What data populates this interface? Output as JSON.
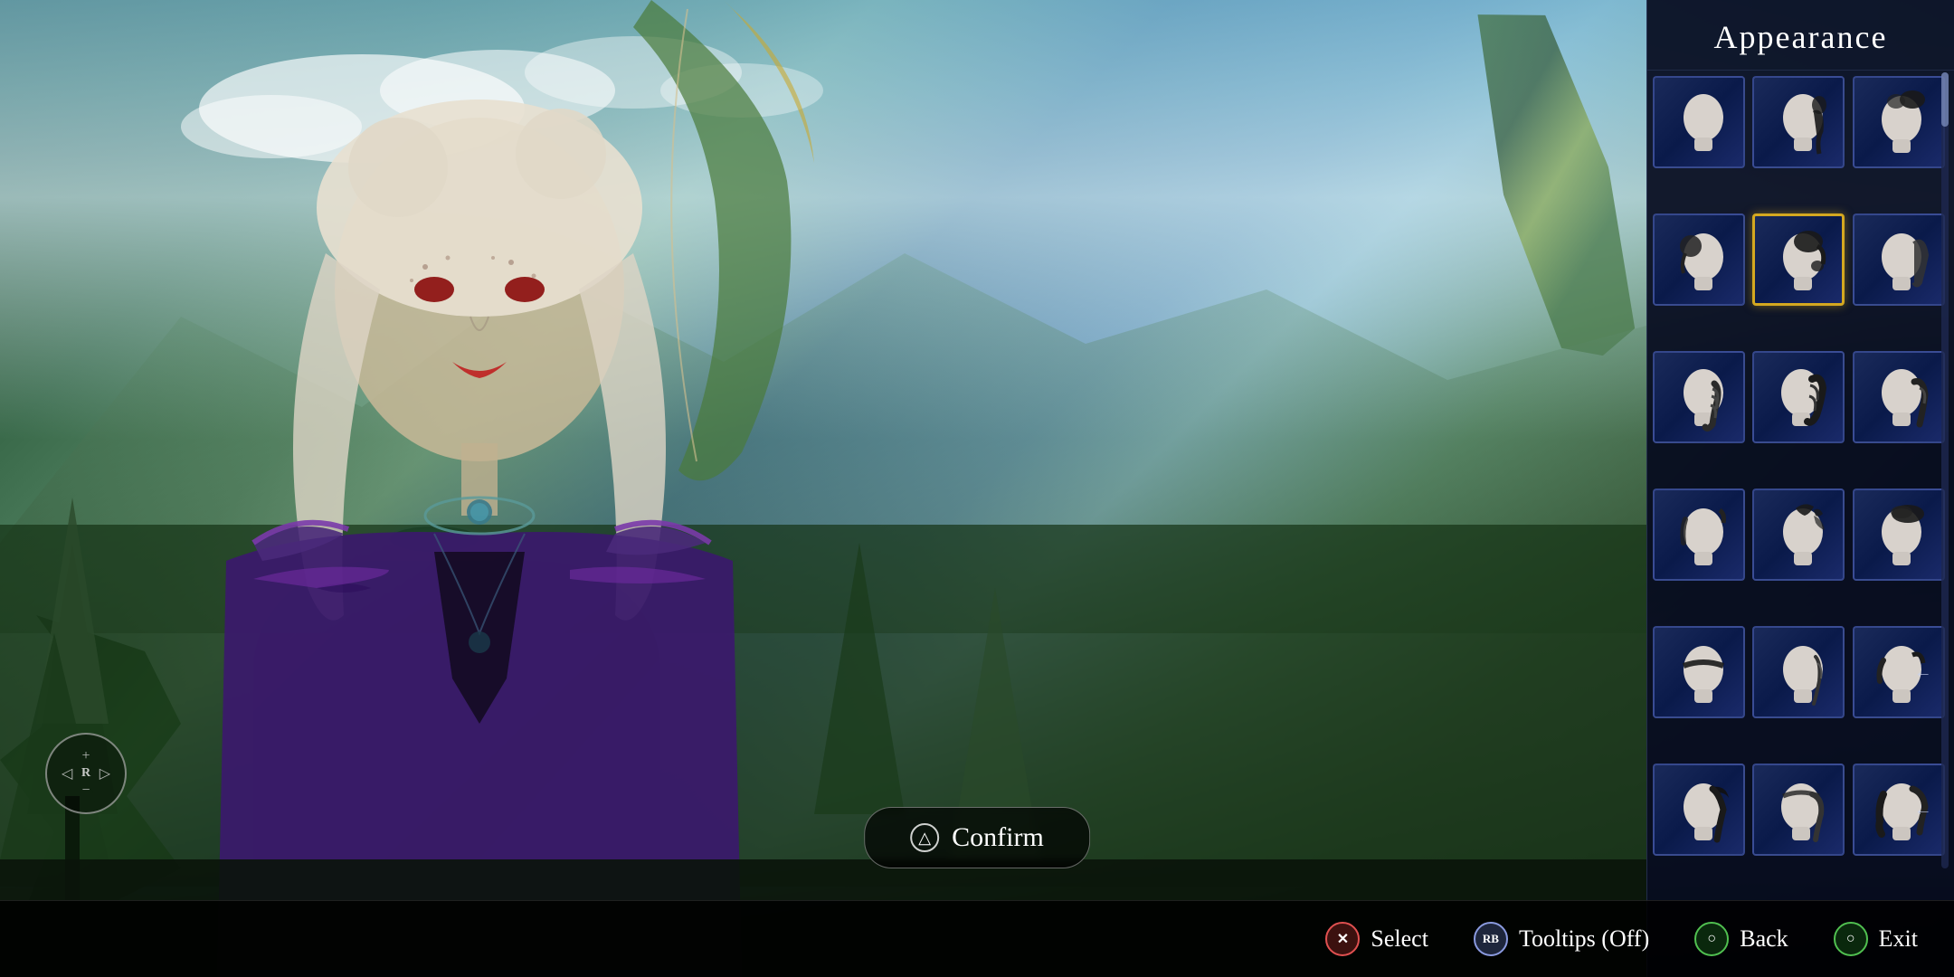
{
  "ui": {
    "title": "Appearance",
    "confirm_button": {
      "label": "Confirm",
      "icon": "△"
    },
    "compass": {
      "label": "R",
      "plus": "+",
      "minus": "-"
    },
    "bottom_bar": {
      "actions": [
        {
          "icon": "✕",
          "label": "Select",
          "icon_class": "cross"
        },
        {
          "icon": "RB",
          "label": "Tooltips (Off)",
          "icon_class": "plain"
        },
        {
          "icon": "○",
          "label": "Back",
          "icon_class": "circle"
        },
        {
          "icon": "○",
          "label": "Exit",
          "icon_class": "circle"
        }
      ]
    },
    "hair_grid": {
      "rows": 6,
      "cols": 3,
      "selected_row": 1,
      "selected_col": 1,
      "items": [
        {
          "id": 0,
          "row": 0,
          "col": 0,
          "style": "bald"
        },
        {
          "id": 1,
          "row": 0,
          "col": 1,
          "style": "ponytail-low"
        },
        {
          "id": 2,
          "row": 0,
          "col": 2,
          "style": "bun-top"
        },
        {
          "id": 3,
          "row": 1,
          "col": 0,
          "style": "bun-side"
        },
        {
          "id": 4,
          "row": 1,
          "col": 1,
          "style": "bun-back",
          "selected": true
        },
        {
          "id": 5,
          "row": 1,
          "col": 2,
          "style": "ponytail-side"
        },
        {
          "id": 6,
          "row": 2,
          "col": 0,
          "style": "braid-back"
        },
        {
          "id": 7,
          "row": 2,
          "col": 1,
          "style": "braid-dark"
        },
        {
          "id": 8,
          "row": 2,
          "col": 2,
          "style": "ponytail-dark"
        },
        {
          "id": 9,
          "row": 3,
          "col": 0,
          "style": "short-side"
        },
        {
          "id": 10,
          "row": 3,
          "col": 1,
          "style": "mohawk"
        },
        {
          "id": 11,
          "row": 3,
          "col": 2,
          "style": "bun-tight"
        },
        {
          "id": 12,
          "row": 4,
          "col": 0,
          "style": "headband"
        },
        {
          "id": 13,
          "row": 4,
          "col": 1,
          "style": "strand-side"
        },
        {
          "id": 14,
          "row": 4,
          "col": 2,
          "style": "tied-back"
        },
        {
          "id": 15,
          "row": 5,
          "col": 0,
          "style": "undercut-long"
        },
        {
          "id": 16,
          "row": 5,
          "col": 1,
          "style": "half-up"
        },
        {
          "id": 17,
          "row": 5,
          "col": 2,
          "style": "layered-dark"
        }
      ]
    }
  },
  "colors": {
    "panel_bg": "#05071e",
    "selected_border": "#d4a820",
    "item_bg": "#0a1545",
    "title_color": "#ffffff",
    "head_color": "#d8d2cc",
    "hair_dark": "#1a1a1a",
    "hair_med": "#444",
    "bottom_bar_bg": "#000000"
  }
}
